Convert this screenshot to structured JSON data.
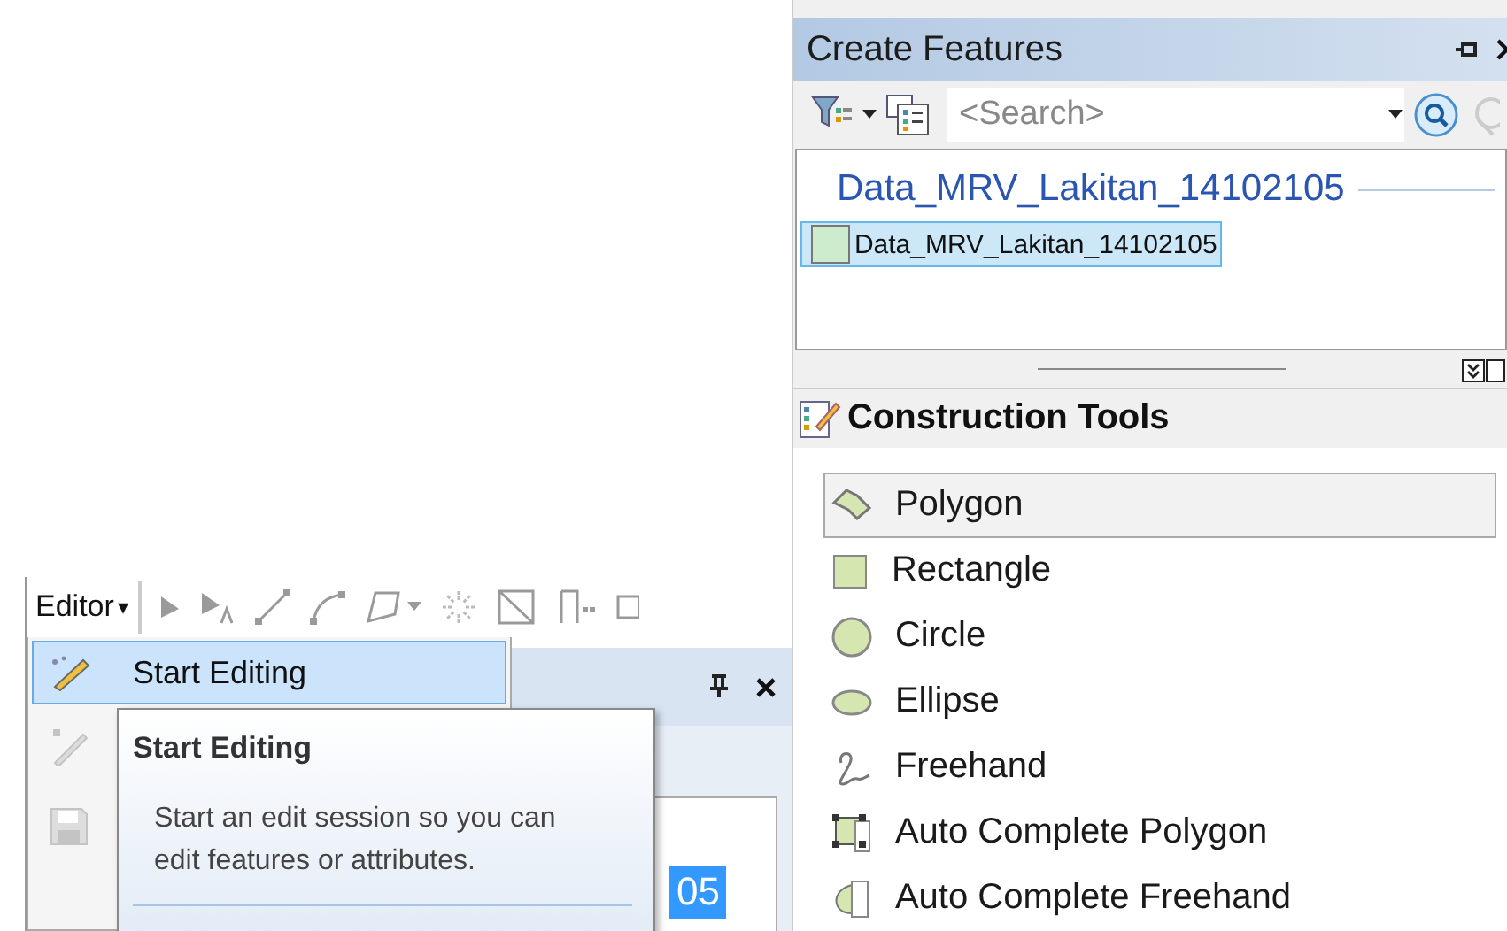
{
  "editor_toolbar": {
    "menu_label": "Editor",
    "menu_arrow": "▾"
  },
  "editor_menu": {
    "items": [
      {
        "kind": "start",
        "label": "Start Editing",
        "selected": true,
        "disabled": false
      },
      {
        "kind": "stop",
        "disabled": true
      },
      {
        "kind": "save",
        "disabled": true
      }
    ]
  },
  "tooltip": {
    "title": "Start Editing",
    "description": "Start an edit session so you can edit features or attributes."
  },
  "docked_window": {
    "selected_text": "05"
  },
  "create_features": {
    "title": "Create Features",
    "search": {
      "placeholder": "<Search>"
    },
    "template_group": "Data_MRV_Lakitan_14102105",
    "templates": [
      {
        "label": "Data_MRV_Lakitan_14102105",
        "color": "#cdeccd",
        "selected": true
      }
    ]
  },
  "construction_tools": {
    "title": "Construction Tools",
    "tools": [
      {
        "kind": "polygon",
        "label": "Polygon",
        "selected": true
      },
      {
        "kind": "rectangle",
        "label": "Rectangle",
        "selected": false
      },
      {
        "kind": "circle",
        "label": "Circle",
        "selected": false
      },
      {
        "kind": "ellipse",
        "label": "Ellipse",
        "selected": false
      },
      {
        "kind": "freehand",
        "label": "Freehand",
        "selected": false
      },
      {
        "kind": "auto_polygon",
        "label": "Auto Complete Polygon",
        "selected": false
      },
      {
        "kind": "auto_freehand",
        "label": "Auto Complete Freehand",
        "selected": false
      }
    ]
  }
}
